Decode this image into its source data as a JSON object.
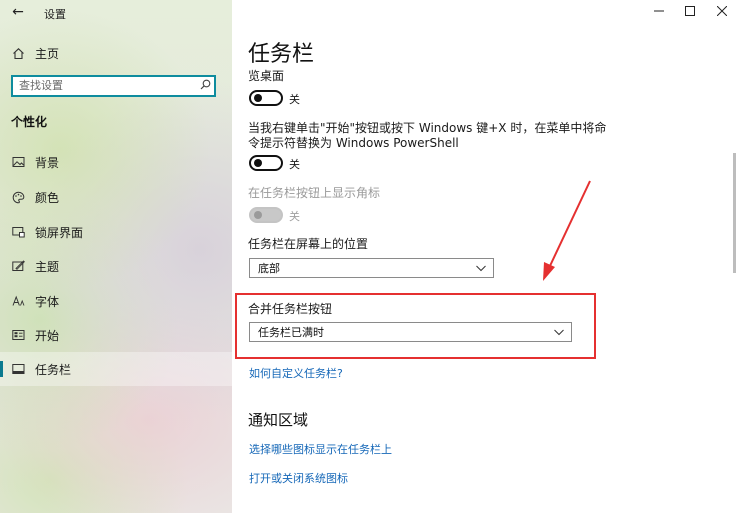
{
  "app": {
    "title": "设置"
  },
  "sidebar": {
    "search_placeholder": "查找设置",
    "section_label": "个性化",
    "home_label": "主页",
    "items": [
      {
        "label": "背景",
        "icon": "picture-icon"
      },
      {
        "label": "颜色",
        "icon": "palette-icon"
      },
      {
        "label": "锁屏界面",
        "icon": "lock-screen-icon"
      },
      {
        "label": "主题",
        "icon": "theme-icon"
      },
      {
        "label": "字体",
        "icon": "font-icon"
      },
      {
        "label": "开始",
        "icon": "start-icon"
      },
      {
        "label": "任务栏",
        "icon": "taskbar-icon",
        "selected": true
      }
    ]
  },
  "main": {
    "title": "任务栏",
    "settings": {
      "peek_label": "览桌面",
      "peek_state": "关",
      "powershell_label_line1": "当我右键单击\"开始\"按钮或按下 Windows 键+X 时，在菜单中将命",
      "powershell_label_line2": "令提示符替换为 Windows PowerShell",
      "powershell_state": "关",
      "badges_label": "在任务栏按钮上显示角标",
      "badges_state": "关",
      "location_label": "任务栏在屏幕上的位置",
      "location_value": "底部",
      "combine_label": "合并任务栏按钮",
      "combine_value": "任务栏已满时",
      "customize_link": "如何自定义任务栏?"
    },
    "notification_area": {
      "title": "通知区域",
      "link_icons": "选择哪些图标显示在任务栏上",
      "link_system_icons": "打开或关闭系统图标"
    }
  },
  "colors": {
    "accent": "#0e8c9e",
    "link": "#1668b8",
    "highlight": "#e53030"
  }
}
